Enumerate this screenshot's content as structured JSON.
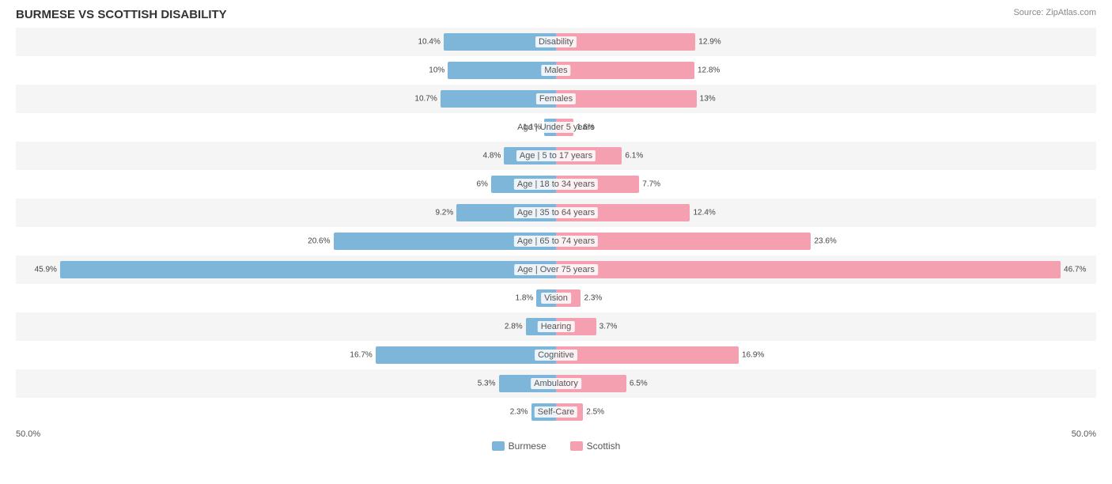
{
  "title": "BURMESE VS SCOTTISH DISABILITY",
  "source": "Source: ZipAtlas.com",
  "chart": {
    "center_pct": 50,
    "max_pct": 50,
    "rows": [
      {
        "label": "Disability",
        "burmese": 10.4,
        "scottish": 12.9
      },
      {
        "label": "Males",
        "burmese": 10.0,
        "scottish": 12.8
      },
      {
        "label": "Females",
        "burmese": 10.7,
        "scottish": 13.0
      },
      {
        "label": "Age | Under 5 years",
        "burmese": 1.1,
        "scottish": 1.6
      },
      {
        "label": "Age | 5 to 17 years",
        "burmese": 4.8,
        "scottish": 6.1
      },
      {
        "label": "Age | 18 to 34 years",
        "burmese": 6.0,
        "scottish": 7.7
      },
      {
        "label": "Age | 35 to 64 years",
        "burmese": 9.2,
        "scottish": 12.4
      },
      {
        "label": "Age | 65 to 74 years",
        "burmese": 20.6,
        "scottish": 23.6
      },
      {
        "label": "Age | Over 75 years",
        "burmese": 45.9,
        "scottish": 46.7
      },
      {
        "label": "Vision",
        "burmese": 1.8,
        "scottish": 2.3
      },
      {
        "label": "Hearing",
        "burmese": 2.8,
        "scottish": 3.7
      },
      {
        "label": "Cognitive",
        "burmese": 16.7,
        "scottish": 16.9
      },
      {
        "label": "Ambulatory",
        "burmese": 5.3,
        "scottish": 6.5
      },
      {
        "label": "Self-Care",
        "burmese": 2.3,
        "scottish": 2.5
      }
    ],
    "axis_left": "50.0%",
    "axis_right": "50.0%"
  },
  "legend": {
    "burmese_label": "Burmese",
    "scottish_label": "Scottish"
  }
}
